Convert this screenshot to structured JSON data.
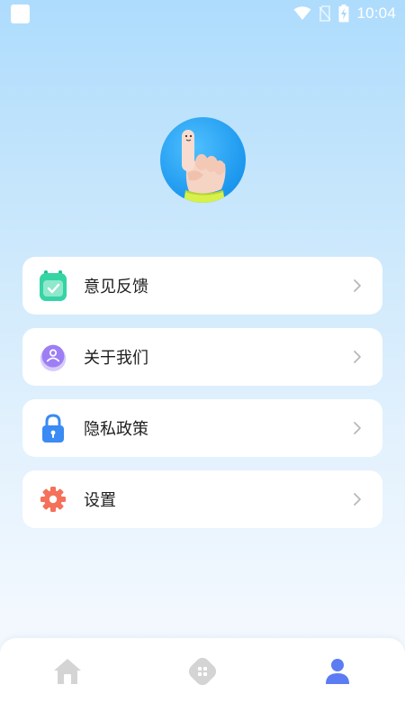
{
  "status_bar": {
    "time": "10:04",
    "icons": [
      "app-notification-icon",
      "wifi-icon",
      "no-sim-icon",
      "battery-charging-icon"
    ]
  },
  "profile": {
    "avatar_icon": "pointing-finger-hand-icon"
  },
  "menu": {
    "items": [
      {
        "label": "意见反馈",
        "icon": "feedback-calendar-icon",
        "color": "#2ed3a1"
      },
      {
        "label": "关于我们",
        "icon": "about-user-icon",
        "color": "#9d7ef5"
      },
      {
        "label": "隐私政策",
        "icon": "lock-icon",
        "color": "#3a8bf3"
      },
      {
        "label": "设置",
        "icon": "gear-icon",
        "color": "#f5715a"
      }
    ]
  },
  "bottom_nav": {
    "items": [
      {
        "icon": "home-icon",
        "active": false
      },
      {
        "icon": "apps-icon",
        "active": false
      },
      {
        "icon": "profile-icon",
        "active": true
      }
    ],
    "active_color": "#5b7cf2",
    "inactive_color": "#d4d4d4"
  }
}
